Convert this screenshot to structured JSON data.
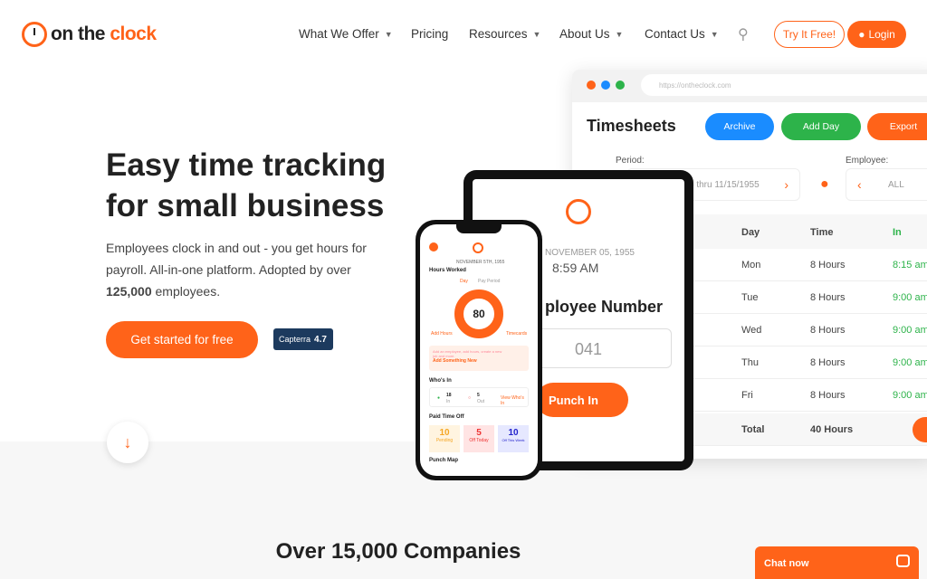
{
  "header": {
    "logo_text_1": "on the",
    "logo_text_2": "clock",
    "nav": [
      "What We Offer",
      "Pricing",
      "Resources",
      "About Us",
      "Contact Us"
    ],
    "try_label": "Try It Free!",
    "login_label": "Login"
  },
  "hero": {
    "title_1": "Easy time tracking",
    "title_2": "for small business",
    "desc": "Employees clock in and out - you get hours for payroll. All-in-one platform. Adopted by over",
    "desc_bold": "125,000",
    "desc_end": " employees.",
    "cta": "Get started for free",
    "capterra": "Capterra",
    "capterra_rating": "4.7"
  },
  "desktop": {
    "url": "https://ontheclock.com",
    "title": "Timesheets",
    "archive": "Archive",
    "add_day": "Add Day",
    "export": "Export",
    "period_label": "Period:",
    "period_value": "5 thru 11/15/1955",
    "employee_label": "Employee:",
    "employee_value": "ALL",
    "columns": [
      "Day",
      "Time",
      "In"
    ],
    "rows": [
      {
        "day": "Mon",
        "time": "8 Hours",
        "in": "8:15 am"
      },
      {
        "day": "Tue",
        "time": "8 Hours",
        "in": "9:00 am"
      },
      {
        "day": "Wed",
        "time": "8 Hours",
        "in": "9:00 am"
      },
      {
        "day": "Thu",
        "time": "8 Hours",
        "in": "9:00 am"
      },
      {
        "day": "Fri",
        "time": "8 Hours",
        "in": "9:00 am"
      }
    ],
    "total_label": "Total",
    "total_value": "40 Hours"
  },
  "tablet": {
    "date": "NOVEMBER 05, 1955",
    "time": "8:59 AM",
    "heading": "ployee Number",
    "number": "041",
    "punch": "Punch In"
  },
  "phone": {
    "date": "NOVEMBER 5TH, 1955",
    "hours_worked": "Hours Worked",
    "today": "Today",
    "day": "Day",
    "pay_period": "Pay Period",
    "total": "80",
    "add_hours": "Add Hours",
    "timecards": "Timecards",
    "add_text": "Add an employee, add hours, create a new job and more.",
    "add_new": "Add Something New",
    "whos_in": "Who's In",
    "in_count": "18",
    "in": "In",
    "out_count": "5",
    "out": "Out",
    "view": "View Who's In",
    "pto": "Paid Time Off",
    "pending": "10",
    "pending_l": "Pending",
    "off_today": "5",
    "off_today_l": "Off Today",
    "off_week": "10",
    "off_week_l": "Off This Week",
    "punch_map": "Punch Map"
  },
  "section": {
    "title": "Over 15,000 Companies"
  },
  "chat": {
    "label": "Chat now"
  },
  "colors": {
    "accent": "#ff6319",
    "blue": "#1a8cff",
    "green": "#2db34a"
  }
}
